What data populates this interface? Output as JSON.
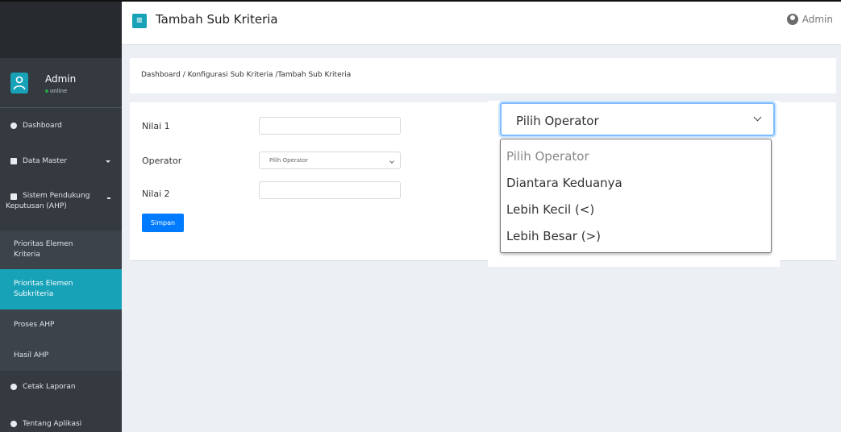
{
  "header": {
    "page_title": "Tambah Sub Kriteria",
    "title_icon": "list-icon",
    "user_label": "Admin"
  },
  "sidebar": {
    "user": {
      "name": "Admin",
      "status": "online"
    },
    "items": [
      {
        "label": "Dashboard",
        "icon": "circle-icon"
      },
      {
        "label": "Data Master",
        "icon": "table-icon"
      },
      {
        "label": "Sistem Pendukung Keputusan (AHP)",
        "line1": "Sistem Pendukung",
        "line2": "Keputusan (AHP)",
        "icon": "document-icon"
      },
      {
        "label": "Prioritas Elemen Kriteria",
        "line1": "Prioritas Elemen",
        "line2": "Kriteria"
      },
      {
        "label": "Prioritas Elemen Subkriteria",
        "line1": "Prioritas Elemen",
        "line2": "Subkriteria"
      },
      {
        "label": "Proses AHP"
      },
      {
        "label": "Hasil AHP"
      },
      {
        "label": "Cetak Laporan",
        "icon": "circle-icon"
      },
      {
        "label": "Tentang Aplikasi",
        "icon": "info-icon"
      }
    ],
    "active_color": "#17a2b8"
  },
  "breadcrumb": "Dashboard / Konfigurasi Sub Kriteria /Tambah Sub Kriteria",
  "form": {
    "nilai1_label": "Nilai 1",
    "nilai1_value": "",
    "operator_label": "Operator",
    "operator_value": "Pilih Operator",
    "nilai2_label": "Nilai 2",
    "nilai2_value": "",
    "submit_label": "Simpan"
  },
  "dropdown": {
    "selected": "Pilih Operator",
    "options": [
      "Pilih Operator",
      "Diantara Keduanya",
      "Lebih Kecil (<)",
      "Lebih Besar (>)"
    ]
  },
  "colors": {
    "sidebar_bg": "#343a40",
    "accent": "#17a2b8",
    "primary_button": "#007bff",
    "content_bg": "#ecf0f5"
  }
}
